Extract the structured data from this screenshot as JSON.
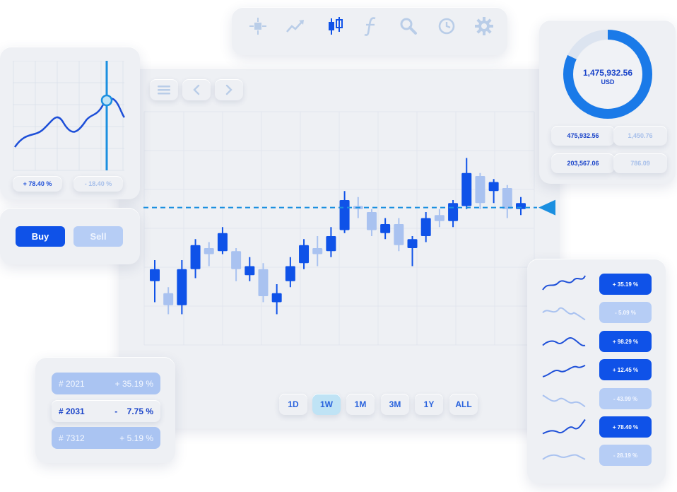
{
  "toolbar": {
    "icons": [
      "crosshair-icon",
      "trend-line-icon",
      "candlestick-icon",
      "function-icon",
      "search-icon",
      "clock-icon",
      "gear-icon"
    ]
  },
  "nav": {
    "icons": [
      "menu-icon",
      "chevron-left-icon",
      "chevron-right-icon"
    ]
  },
  "mini_chart": {
    "stat_positive": "+ 78.40 %",
    "stat_negative": "- 18.40 %"
  },
  "trade": {
    "buy_label": "Buy",
    "sell_label": "Sell"
  },
  "balance": {
    "amount": "1,475,932.56",
    "currency": "USD",
    "ring_fraction": 0.82,
    "stats": [
      "475,932.56",
      "1,450.76",
      "203,567.06",
      "786.09"
    ]
  },
  "chart_data": {
    "type": "candlestick",
    "series": [
      {
        "open": 0.62,
        "close": 0.66,
        "high": 0.69,
        "low": 0.55,
        "dir": "up"
      },
      {
        "open": 0.58,
        "close": 0.54,
        "high": 0.6,
        "low": 0.51,
        "dir": "down"
      },
      {
        "open": 0.54,
        "close": 0.66,
        "high": 0.69,
        "low": 0.51,
        "dir": "up"
      },
      {
        "open": 0.66,
        "close": 0.74,
        "high": 0.76,
        "low": 0.63,
        "dir": "up"
      },
      {
        "open": 0.73,
        "close": 0.71,
        "high": 0.75,
        "low": 0.67,
        "dir": "down"
      },
      {
        "open": 0.72,
        "close": 0.78,
        "high": 0.8,
        "low": 0.71,
        "dir": "up"
      },
      {
        "open": 0.72,
        "close": 0.66,
        "high": 0.73,
        "low": 0.62,
        "dir": "down"
      },
      {
        "open": 0.67,
        "close": 0.64,
        "high": 0.7,
        "low": 0.62,
        "dir": "up"
      },
      {
        "open": 0.66,
        "close": 0.57,
        "high": 0.68,
        "low": 0.55,
        "dir": "down"
      },
      {
        "open": 0.58,
        "close": 0.55,
        "high": 0.61,
        "low": 0.51,
        "dir": "up"
      },
      {
        "open": 0.62,
        "close": 0.67,
        "high": 0.7,
        "low": 0.6,
        "dir": "up"
      },
      {
        "open": 0.68,
        "close": 0.74,
        "high": 0.76,
        "low": 0.66,
        "dir": "up"
      },
      {
        "open": 0.73,
        "close": 0.71,
        "high": 0.77,
        "low": 0.67,
        "dir": "down"
      },
      {
        "open": 0.72,
        "close": 0.77,
        "high": 0.8,
        "low": 0.7,
        "dir": "up"
      },
      {
        "open": 0.79,
        "close": 0.89,
        "high": 0.92,
        "low": 0.78,
        "dir": "up"
      },
      {
        "open": 0.87,
        "close": 0.86,
        "high": 0.9,
        "low": 0.83,
        "dir": "down"
      },
      {
        "open": 0.85,
        "close": 0.79,
        "high": 0.86,
        "low": 0.77,
        "dir": "down"
      },
      {
        "open": 0.78,
        "close": 0.81,
        "high": 0.83,
        "low": 0.76,
        "dir": "up"
      },
      {
        "open": 0.81,
        "close": 0.74,
        "high": 0.83,
        "low": 0.72,
        "dir": "down"
      },
      {
        "open": 0.73,
        "close": 0.76,
        "high": 0.77,
        "low": 0.67,
        "dir": "up"
      },
      {
        "open": 0.77,
        "close": 0.83,
        "high": 0.85,
        "low": 0.75,
        "dir": "up"
      },
      {
        "open": 0.82,
        "close": 0.84,
        "high": 0.86,
        "low": 0.8,
        "dir": "down"
      },
      {
        "open": 0.82,
        "close": 0.88,
        "high": 0.89,
        "low": 0.8,
        "dir": "up"
      },
      {
        "open": 0.87,
        "close": 0.98,
        "high": 1.03,
        "low": 0.86,
        "dir": "up"
      },
      {
        "open": 0.97,
        "close": 0.88,
        "high": 0.98,
        "low": 0.86,
        "dir": "down"
      },
      {
        "open": 0.92,
        "close": 0.95,
        "high": 0.96,
        "low": 0.88,
        "dir": "up"
      },
      {
        "open": 0.93,
        "close": 0.86,
        "high": 0.94,
        "low": 0.83,
        "dir": "down"
      },
      {
        "open": 0.86,
        "close": 0.88,
        "high": 0.9,
        "low": 0.84,
        "dir": "up"
      }
    ],
    "reference_level": 0.865,
    "ylim": [
      0.45,
      1.05
    ]
  },
  "timeframes": [
    "1D",
    "1W",
    "1M",
    "3M",
    "1Y",
    "ALL"
  ],
  "active_timeframe": "1W",
  "movers": [
    {
      "value": "+ 35.19 %",
      "style": "dark"
    },
    {
      "value": "-   5.09 %",
      "style": "light"
    },
    {
      "value": "+ 98.29 %",
      "style": "dark"
    },
    {
      "value": "+ 12.45 %",
      "style": "dark"
    },
    {
      "value": "-  43.99 %",
      "style": "light"
    },
    {
      "value": "+ 78.40 %",
      "style": "dark"
    },
    {
      "value": "-  28.19 %",
      "style": "light"
    }
  ],
  "portfolio": [
    {
      "id": "# 2021",
      "sign": "+",
      "value": "35.19 %",
      "style": "light"
    },
    {
      "id": "# 2031",
      "sign": "-",
      "value": "7.75 %",
      "style": "plain"
    },
    {
      "id": "# 7312",
      "sign": "+",
      "value": "5.19 %",
      "style": "light"
    }
  ],
  "colors": {
    "accent": "#0f52e8",
    "light": "#aac4f2",
    "panel": "#eef0f4",
    "dash": "#1a8fe0"
  }
}
